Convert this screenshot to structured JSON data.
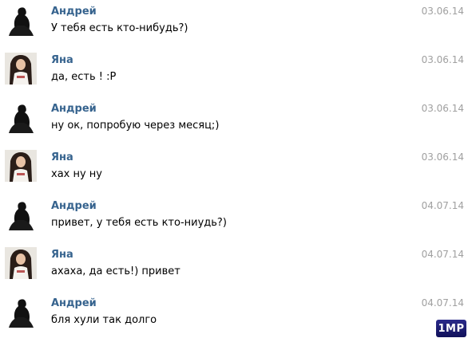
{
  "messages": [
    {
      "author": "Андрей",
      "text": "У тебя есть кто-нибудь?)",
      "date": "03.06.14",
      "avatar": "andrey"
    },
    {
      "author": "Яна",
      "text": "да, есть ! :P",
      "date": "03.06.14",
      "avatar": "yana"
    },
    {
      "author": "Андрей",
      "text": "ну ок, попробую через месяц;)",
      "date": "03.06.14",
      "avatar": "andrey"
    },
    {
      "author": "Яна",
      "text": "хах ну ну",
      "date": "03.06.14",
      "avatar": "yana"
    },
    {
      "author": "Андрей",
      "text": "привет, у тебя есть кто-ниудь?)",
      "date": "04.07.14",
      "avatar": "andrey"
    },
    {
      "author": "Яна",
      "text": "ахаха, да есть!) привет",
      "date": "04.07.14",
      "avatar": "yana"
    },
    {
      "author": "Андрей",
      "text": "бля хули так долго",
      "date": "04.07.14",
      "avatar": "andrey"
    }
  ],
  "watermark": {
    "text": "1MP"
  },
  "colors": {
    "author": "#36638e",
    "date": "#a0a0a0",
    "text": "#000000"
  }
}
